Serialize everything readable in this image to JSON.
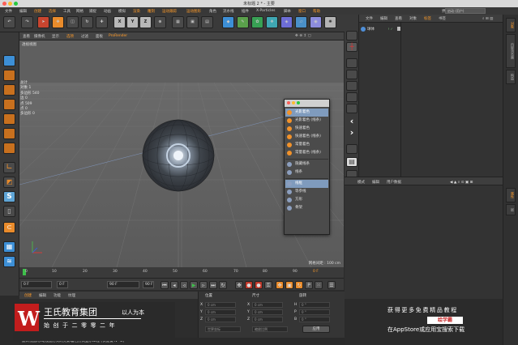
{
  "window": {
    "title": "未标题 2 * - 主要"
  },
  "menubar": {
    "items": [
      "文件",
      "编辑",
      "创建",
      "选择",
      "工具",
      "网格",
      "捕捉",
      "动画",
      "模拟",
      "渲染",
      "雕刻",
      "运动跟踪",
      "运动图形",
      "角色",
      "流水线",
      "插件",
      "X-Particles",
      "脚本",
      "窗口",
      "帮助"
    ],
    "layout_label": "界面",
    "layout_value": "启动 (用户)"
  },
  "toolbar": {
    "axis_labels": [
      "X",
      "Y",
      "Z"
    ]
  },
  "viewport": {
    "menu": [
      "查看",
      "摄像机",
      "显示",
      "选项",
      "过滤",
      "面板",
      "ProRender"
    ],
    "camera_label": "透视视图",
    "stats": [
      {
        "label": "总计",
        "value": ""
      },
      {
        "label": "对象",
        "value": "1"
      },
      {
        "label": "多边形",
        "value": "540"
      },
      {
        "label": "边",
        "value": "0"
      },
      {
        "label": "点",
        "value": "509"
      },
      {
        "label": "点",
        "value": "0"
      },
      {
        "label": "多边形",
        "value": "0"
      }
    ],
    "grid_spacing": "网格间距 : 100 cm"
  },
  "display_menu": {
    "items": [
      {
        "label": "光影着色",
        "color": "#f2922a",
        "selected": true
      },
      {
        "label": "光影着色 (线条)",
        "color": "#f2922a",
        "selected": false
      },
      {
        "label": "快速着色",
        "color": "#f2922a",
        "selected": false
      },
      {
        "label": "快速着色 (线条)",
        "color": "#f2922a",
        "selected": false
      },
      {
        "label": "常量着色",
        "color": "#f2922a",
        "selected": false
      },
      {
        "label": "常量着色 (线条)",
        "color": "#f2922a",
        "selected": false
      },
      {
        "label": "隐藏线条",
        "color": "#8c9fbf",
        "selected": false
      },
      {
        "label": "线条",
        "color": "#8c9fbf",
        "selected": false
      },
      {
        "label": "线框",
        "color": "#8c9fbf",
        "selected": true
      },
      {
        "label": "等参线",
        "color": "#8c9fbf",
        "selected": false
      },
      {
        "label": "方形",
        "color": "#8c9fbf",
        "selected": false
      },
      {
        "label": "骨架",
        "color": "#8c9fbf",
        "selected": false
      }
    ]
  },
  "object_manager": {
    "menu": [
      "文件",
      "编辑",
      "查看",
      "对象",
      "标签",
      "书签"
    ],
    "active_menu_index": 4,
    "objects": [
      {
        "name": "球体"
      }
    ]
  },
  "attribute_manager": {
    "menu": [
      "模式",
      "编辑",
      "用户数据"
    ]
  },
  "side_tabs": [
    "对象",
    "内容浏览器",
    "构造",
    "属性",
    "层"
  ],
  "timeline": {
    "ticks": [
      "0",
      "10",
      "20",
      "30",
      "40",
      "50",
      "60",
      "70",
      "80",
      "90"
    ],
    "end_frame": "0 F"
  },
  "transport": {
    "current_frame": "0 F",
    "start_frame": "0 F",
    "end_frame": "90 F",
    "end_frame2": "90 F"
  },
  "material_manager": {
    "menu": [
      "创建",
      "编辑",
      "功能",
      "纹理"
    ]
  },
  "coordinates": {
    "headers": [
      "位置",
      "尺寸",
      "旋转"
    ],
    "rows": [
      {
        "axis": "X",
        "pos": "0 cm",
        "axis2": "X",
        "size": "0 cm",
        "rot_axis": "H",
        "rot": "0 °"
      },
      {
        "axis": "Y",
        "pos": "0 cm",
        "axis2": "Y",
        "size": "0 cm",
        "rot_axis": "P",
        "rot": "0 °"
      },
      {
        "axis": "Z",
        "pos": "0 cm",
        "axis2": "Z",
        "size": "0 cm",
        "rot_axis": "B",
        "rot": "0 °"
      }
    ],
    "mode_left": "世界坐标",
    "mode_right": "缩放比例",
    "apply_label": "应用"
  },
  "status_bar": "旋转视图/移动视图方式的光影着色方式显示工程 [快捷键 N~B]",
  "watermark": {
    "logo_letter": "W",
    "company": "王氏教育集团",
    "tagline": "以人为本",
    "founded": "始创于二零零二年",
    "promo_line1": "获得更多免费精品教程",
    "brand": "绘学霸",
    "promo_line3": "在AppStore或应用宝搜索下载"
  }
}
